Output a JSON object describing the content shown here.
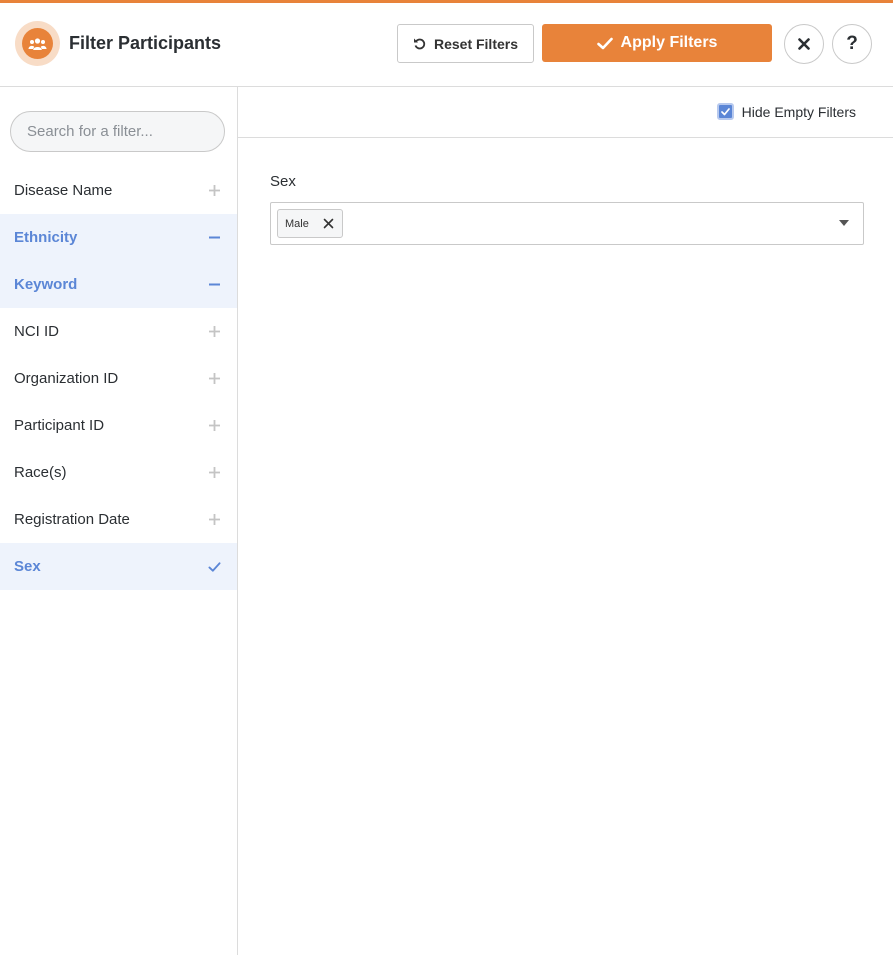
{
  "header": {
    "title": "Filter Participants",
    "logo_icon": "participants-group-icon",
    "reset_label": "Reset Filters",
    "apply_label": "Apply Filters",
    "close_icon": "close-icon",
    "help_label": "?"
  },
  "colors": {
    "accent": "#e8833a",
    "active_blue": "#5b86d6",
    "active_bg": "#eef3fc"
  },
  "sidebar": {
    "search_placeholder": "Search for a filter...",
    "items": [
      {
        "label": "Disease Name",
        "state": "add"
      },
      {
        "label": "Ethnicity",
        "state": "remove"
      },
      {
        "label": "Keyword",
        "state": "remove"
      },
      {
        "label": "NCI ID",
        "state": "add"
      },
      {
        "label": "Organization ID",
        "state": "add"
      },
      {
        "label": "Participant ID",
        "state": "add"
      },
      {
        "label": "Race(s)",
        "state": "add"
      },
      {
        "label": "Registration Date",
        "state": "add"
      },
      {
        "label": "Sex",
        "state": "selected"
      }
    ]
  },
  "main": {
    "hide_empty_label": "Hide Empty Filters",
    "hide_empty_checked": true,
    "field": {
      "label": "Sex",
      "selected_values": [
        "Male"
      ]
    }
  }
}
